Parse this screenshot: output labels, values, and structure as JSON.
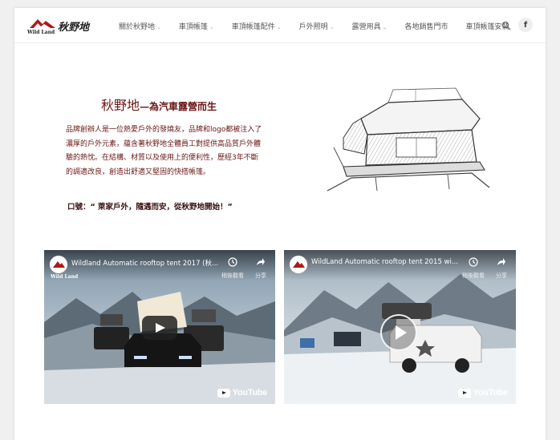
{
  "brand": {
    "logo_text": "Wild Land",
    "logo_cn": "秋野地"
  },
  "nav": {
    "items": [
      {
        "label": "關於秋野地",
        "has_dropdown": true
      },
      {
        "label": "車頂帳篷",
        "has_dropdown": true
      },
      {
        "label": "車頂帳篷配件",
        "has_dropdown": true
      },
      {
        "label": "戶外照明",
        "has_dropdown": true
      },
      {
        "label": "露營用具",
        "has_dropdown": true
      },
      {
        "label": "各地銷售門市",
        "has_dropdown": false
      },
      {
        "label": "車頂帳篷安裝",
        "has_dropdown": false
      }
    ],
    "search_icon": "search-icon",
    "social_icon": "facebook-icon",
    "social_label": "f"
  },
  "intro": {
    "title_main": "秋野地",
    "title_sub": "—為汽車露營而生",
    "body": "品牌創辦人是一位熱愛戶外的發燒友，品牌和logo都被注入了濃厚的戶外元素，蘊含著秋野地全體員工對提供高品質戶外體驗的熱忱。在結構、材質以及使用上的便利性，歷經3年不斷的調適改良，創造出舒適又堅固的快搭帳篷。",
    "slogan": "口號：“ 萊家戶外，隨遇而安，從秋野地開始！”"
  },
  "colors": {
    "accent": "#6b1515",
    "slogan": "#3a1010"
  },
  "videos": [
    {
      "title": "Wildland Automatic rooftop tent 2017 (秋...",
      "watch_later": "稍後觀看",
      "share": "分享",
      "overlay_logo": "Wild Land",
      "brand": "YouTube"
    },
    {
      "title": "WildLand Automatic rooftop tent 2015 wi...",
      "watch_later": "稍後觀看",
      "share": "分享",
      "brand": "YouTube"
    }
  ]
}
